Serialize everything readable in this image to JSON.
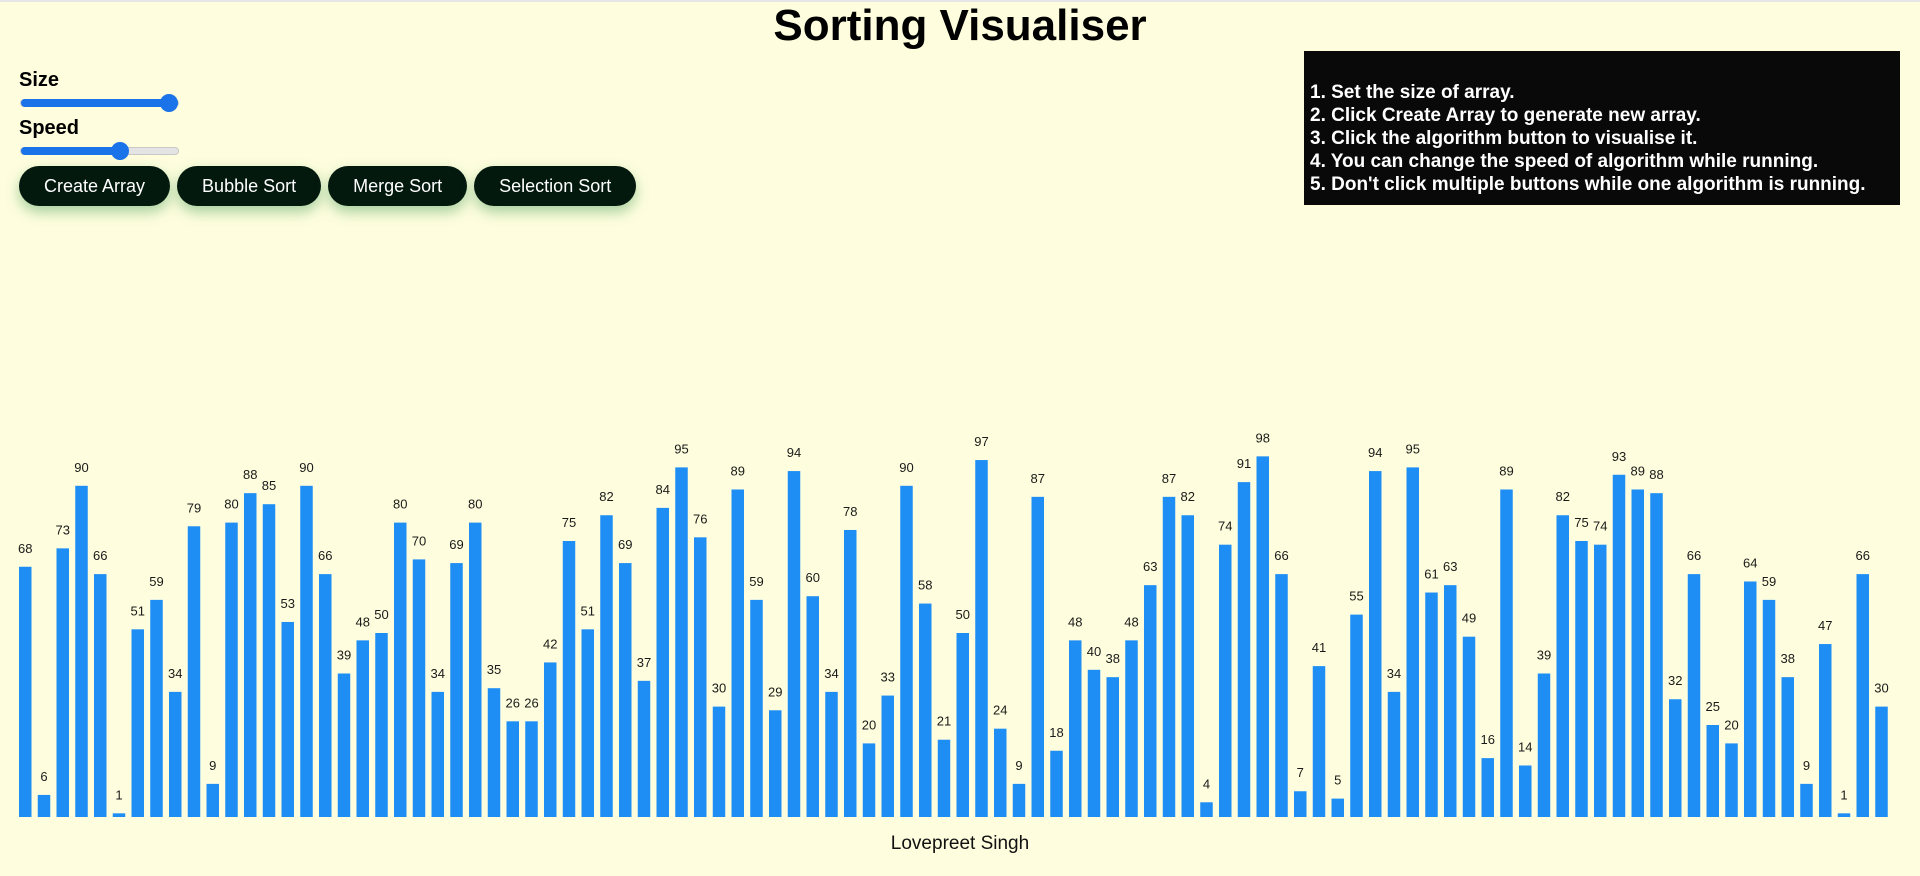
{
  "title": "Sorting Visualiser",
  "controls": {
    "size_label": "Size",
    "size_value": 1.0,
    "speed_label": "Speed",
    "speed_value": 0.65
  },
  "buttons": {
    "create": "Create Array",
    "bubble": "Bubble Sort",
    "merge": "Merge Sort",
    "selection": "Selection Sort"
  },
  "instructions": [
    "1. Set the size of array.",
    "2. Click Create Array to generate new array.",
    "3. Click the algorithm button to visualise it.",
    "4. You can change the speed of algorithm while running.",
    "5. Don't click multiple buttons while one algorithm is running."
  ],
  "colors": {
    "background": "#fefede",
    "bar": "#1e8ef5",
    "slider": "#1a73e8",
    "button": "#04190e",
    "panel": "#090909"
  },
  "chart_data": {
    "type": "bar",
    "values": [
      68,
      6,
      73,
      90,
      66,
      1,
      51,
      59,
      34,
      79,
      9,
      80,
      88,
      85,
      53,
      90,
      66,
      39,
      48,
      50,
      80,
      70,
      34,
      69,
      80,
      35,
      26,
      26,
      42,
      75,
      51,
      82,
      69,
      37,
      84,
      95,
      76,
      30,
      89,
      59,
      29,
      94,
      60,
      34,
      78,
      20,
      33,
      90,
      58,
      21,
      50,
      97,
      24,
      9,
      87,
      18,
      48,
      40,
      38,
      48,
      63,
      87,
      82,
      4,
      74,
      91,
      98,
      66,
      7,
      41,
      5,
      55,
      94,
      34,
      95,
      61,
      63,
      49,
      16,
      89,
      14,
      39,
      82,
      75,
      74,
      93,
      89,
      88,
      32,
      66,
      25,
      20,
      64,
      59,
      38,
      9,
      47,
      1,
      66,
      30
    ],
    "ylim": [
      0,
      100
    ]
  },
  "footer": "Lovepreet Singh"
}
